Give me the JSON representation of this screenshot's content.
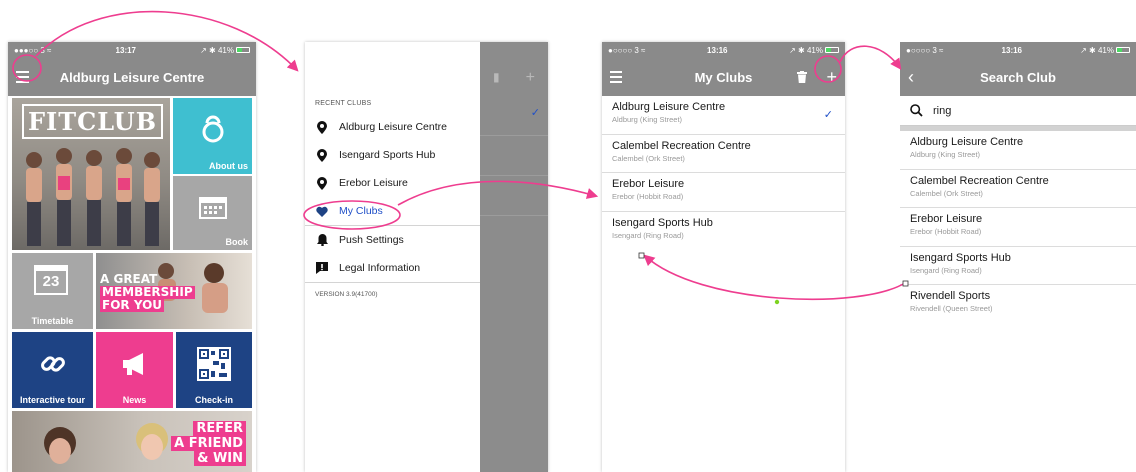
{
  "colors": {
    "accent": "#ee3d8f",
    "bar": "#8a8a8a",
    "check": "#2050c8",
    "tile_teal": "#3fbfd0",
    "tile_gray": "#a7a7a7",
    "tile_navy": "#1e4384",
    "tile_pink": "#ee3d8f"
  },
  "screen1": {
    "status": {
      "left": "●●●○○ 3 ≈",
      "time": "13:17",
      "right": "↗ ✱ 41%"
    },
    "title": "Aldburg Leisure Centre",
    "tiles": {
      "fitclub": "FITCLUB",
      "about": "About us",
      "book": "Book",
      "timetable": "Timetable",
      "calendar_day": "23",
      "membership_line1": "A GREAT",
      "membership_line2": "MEMBERSHIP",
      "membership_line3": "FOR YOU",
      "tour": "Interactive tour",
      "news": "News",
      "checkin": "Check-in",
      "refer_line1": "REFER",
      "refer_line2": "A FRIEND",
      "refer_line3": "& WIN"
    }
  },
  "screen2": {
    "section_label": "RECENT CLUBS",
    "recent": [
      "Aldburg Leisure Centre",
      "Isengard Sports Hub",
      "Erebor Leisure"
    ],
    "my_clubs": "My Clubs",
    "push": "Push Settings",
    "legal": "Legal Information",
    "version": "VERSION  3.9(41700)"
  },
  "screen3": {
    "status": {
      "left": "●○○○○ 3 ≈",
      "time": "13:16",
      "right": "↗ ✱ 41%"
    },
    "title": "My Clubs",
    "clubs": [
      {
        "name": "Aldburg Leisure Centre",
        "sub": "Aldburg (King Street)",
        "checked": "✓"
      },
      {
        "name": "Calembel Recreation Centre",
        "sub": "Calembel (Ork Street)",
        "checked": ""
      },
      {
        "name": "Erebor Leisure",
        "sub": "Erebor (Hobbit Road)",
        "checked": ""
      },
      {
        "name": "Isengard Sports Hub",
        "sub": "Isengard (Ring Road)",
        "checked": ""
      }
    ]
  },
  "screen4": {
    "status": {
      "left": "●○○○○ 3 ≈",
      "time": "13:16",
      "right": "↗ ✱ 41%"
    },
    "title": "Search Club",
    "search_value": "ring",
    "results": [
      {
        "name": "Aldburg Leisure Centre",
        "sub": "Aldburg (King Street)"
      },
      {
        "name": "Calembel Recreation Centre",
        "sub": "Calembel (Ork Street)"
      },
      {
        "name": "Erebor Leisure",
        "sub": "Erebor (Hobbit Road)"
      },
      {
        "name": "Isengard Sports Hub",
        "sub": "Isengard (Ring Road)"
      },
      {
        "name": "Rivendell Sports",
        "sub": "Rivendell (Queen Street)"
      }
    ]
  }
}
